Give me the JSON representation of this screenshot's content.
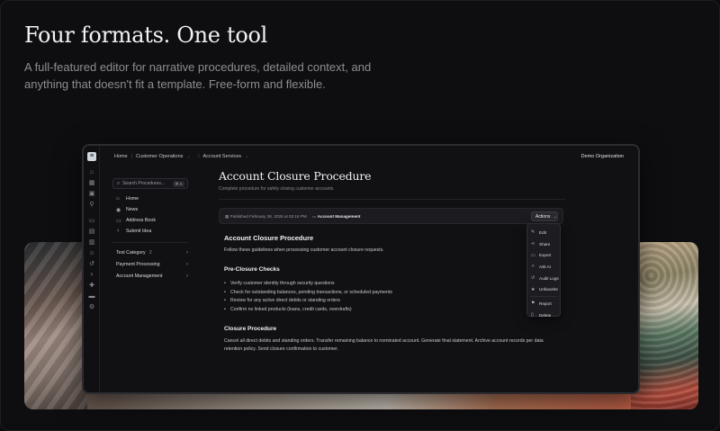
{
  "hero": {
    "title": "Four formats. One tool",
    "subtitle": "A full-featured editor for narrative procedures, detailed context, and anything that doesn't fit a template. Free-form and flexible."
  },
  "app": {
    "breadcrumb": [
      "Home",
      "Customer Operations",
      "Account Services"
    ],
    "org_name": "Demo Organization",
    "sidebar": {
      "search_placeholder": "Search Procedures...",
      "search_shortcut": "⌘ K",
      "nav": [
        {
          "label": "Home",
          "icon": "home-icon"
        },
        {
          "label": "News",
          "icon": "news-icon"
        },
        {
          "label": "Address Book",
          "icon": "address-book-icon"
        },
        {
          "label": "Submit Idea",
          "icon": "lightbulb-icon"
        }
      ],
      "categories": [
        {
          "label": "Test Category",
          "count": "2"
        },
        {
          "label": "Payment Processing",
          "count": ""
        },
        {
          "label": "Account Management",
          "count": ""
        }
      ]
    },
    "document": {
      "title": "Account Closure Procedure",
      "subtitle": "Complete procedure for safely closing customer accounts.",
      "published": "Published February 28, 2026 at 03:16 PM",
      "tag": "Account Management",
      "actions_label": "Actions",
      "heading": "Account Closure Procedure",
      "intro": "Follow these guidelines when processing customer account closure requests.",
      "section1_title": "Pre-Closure Checks",
      "section1_items": [
        "Verify customer identity through security questions",
        "Check for outstanding balances, pending transactions, or scheduled payments",
        "Review for any active direct debits or standing orders",
        "Confirm no linked products (loans, credit cards, overdrafts)"
      ],
      "section2_title": "Closure Procedure",
      "section2_text": "Cancel all direct debits and standing orders. Transfer remaining balance to nominated account. Generate final statement. Archive account records per data retention policy. Send closure confirmation to customer."
    },
    "actions_menu": [
      {
        "label": "Edit",
        "icon": "edit-icon"
      },
      {
        "label": "Share",
        "icon": "share-icon"
      },
      {
        "label": "Export",
        "icon": "export-icon"
      },
      {
        "label": "Ask AI",
        "icon": "ai-icon"
      },
      {
        "label": "Audit Logs",
        "icon": "audit-icon"
      },
      {
        "label": "Unfavorite",
        "icon": "star-icon"
      },
      {
        "label": "Report",
        "icon": "flag-icon"
      },
      {
        "label": "Delete",
        "icon": "trash-icon"
      }
    ]
  }
}
